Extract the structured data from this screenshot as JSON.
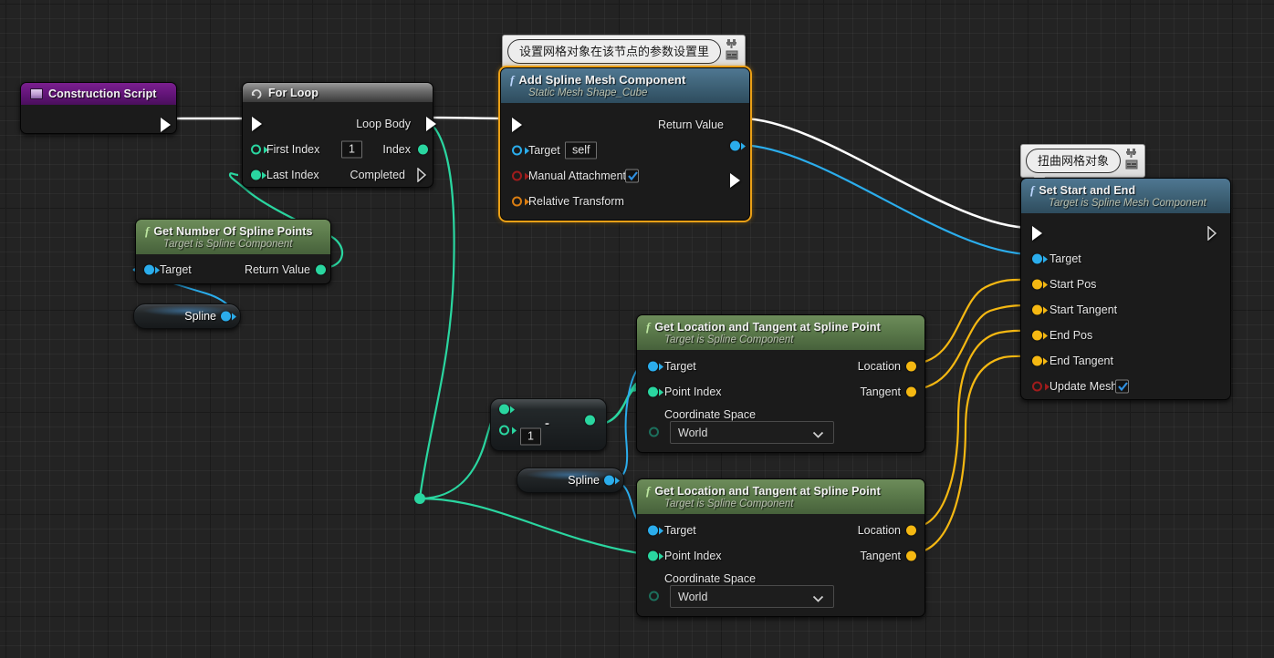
{
  "app": {
    "name": "Unreal Engine Blueprint Graph",
    "canvas_bg": "#232323"
  },
  "colors": {
    "exec_white": "#ffffff",
    "object_blue": "#2badec",
    "integer_green": "#2ad6a0",
    "vector_yellow": "#f5b812",
    "boolean_red": "#a01c1c",
    "transform_orange": "#d97d12",
    "selection_orange": "#eba016",
    "event_purple": "#7b1f8f"
  },
  "comments": [
    {
      "id": "comment-mesh-settings",
      "text": "设置网格对象在该节点的参数设置里",
      "attached_to": "Add Spline Mesh Component"
    },
    {
      "id": "comment-twist-mesh",
      "text": "扭曲网格对象",
      "attached_to": "Set Start and End"
    }
  ],
  "nodes": [
    {
      "id": "construction-script",
      "title": "Construction Script",
      "subtitle": "",
      "kind": "event",
      "icon": "event-icon",
      "outputs": [
        {
          "label": "",
          "type": "exec"
        }
      ],
      "inputs": []
    },
    {
      "id": "for-loop",
      "title": "For Loop",
      "subtitle": "",
      "kind": "flow-control",
      "icon": "loop-icon",
      "inputs": [
        {
          "label": "",
          "type": "exec"
        },
        {
          "label": "First Index",
          "type": "integer",
          "value": "1",
          "connected": false
        },
        {
          "label": "Last Index",
          "type": "integer",
          "connected": true
        }
      ],
      "outputs": [
        {
          "label": "Loop Body",
          "type": "exec"
        },
        {
          "label": "Index",
          "type": "integer"
        },
        {
          "label": "Completed",
          "type": "exec",
          "connected": false
        }
      ]
    },
    {
      "id": "add-spline-mesh-component",
      "title": "Add Spline Mesh Component",
      "subtitle": "Static Mesh Shape_Cube",
      "kind": "function-blue",
      "selected": true,
      "inputs": [
        {
          "label": "",
          "type": "exec"
        },
        {
          "label": "Target",
          "type": "object",
          "value": "self",
          "connected": false
        },
        {
          "label": "Manual Attachment",
          "type": "boolean",
          "checked": true
        },
        {
          "label": "Relative Transform",
          "type": "transform",
          "connected": false
        }
      ],
      "outputs": [
        {
          "label": "",
          "type": "exec"
        },
        {
          "label": "Return Value",
          "type": "object"
        }
      ]
    },
    {
      "id": "get-number-of-spline-points",
      "title": "Get Number Of Spline Points",
      "subtitle": "Target is Spline Component",
      "kind": "function-green",
      "inputs": [
        {
          "label": "Target",
          "type": "object",
          "connected": true
        }
      ],
      "outputs": [
        {
          "label": "Return Value",
          "type": "integer"
        }
      ]
    },
    {
      "id": "spline-var-1",
      "title": "Spline",
      "kind": "variable-get",
      "outputs": [
        {
          "label": "Spline",
          "type": "object"
        }
      ]
    },
    {
      "id": "subtract-node",
      "title": "-",
      "kind": "math",
      "operator": "-",
      "inputs": [
        {
          "label": "",
          "type": "integer",
          "connected": true
        },
        {
          "label": "",
          "type": "integer",
          "value": "1",
          "connected": false
        }
      ],
      "outputs": [
        {
          "label": "",
          "type": "integer"
        }
      ]
    },
    {
      "id": "spline-var-2",
      "title": "Spline",
      "kind": "variable-get",
      "outputs": [
        {
          "label": "Spline",
          "type": "object"
        }
      ]
    },
    {
      "id": "get-location-tangent-1",
      "title": "Get Location and Tangent at Spline Point",
      "subtitle": "Target is Spline Component",
      "kind": "function-green",
      "inputs": [
        {
          "label": "Target",
          "type": "object",
          "connected": true
        },
        {
          "label": "Point Index",
          "type": "integer",
          "connected": true
        },
        {
          "label": "Coordinate Space",
          "type": "enum",
          "value": "World",
          "connected": false
        }
      ],
      "outputs": [
        {
          "label": "Location",
          "type": "vector"
        },
        {
          "label": "Tangent",
          "type": "vector"
        }
      ]
    },
    {
      "id": "get-location-tangent-2",
      "title": "Get Location and Tangent at Spline Point",
      "subtitle": "Target is Spline Component",
      "kind": "function-green",
      "inputs": [
        {
          "label": "Target",
          "type": "object",
          "connected": true
        },
        {
          "label": "Point Index",
          "type": "integer",
          "connected": true
        },
        {
          "label": "Coordinate Space",
          "type": "enum",
          "value": "World",
          "connected": false
        }
      ],
      "outputs": [
        {
          "label": "Location",
          "type": "vector"
        },
        {
          "label": "Tangent",
          "type": "vector"
        }
      ]
    },
    {
      "id": "set-start-and-end",
      "title": "Set Start and End",
      "subtitle": "Target is Spline Mesh Component",
      "kind": "function-blue",
      "inputs": [
        {
          "label": "",
          "type": "exec"
        },
        {
          "label": "Target",
          "type": "object",
          "connected": true
        },
        {
          "label": "Start Pos",
          "type": "vector",
          "connected": true
        },
        {
          "label": "Start Tangent",
          "type": "vector",
          "connected": true
        },
        {
          "label": "End Pos",
          "type": "vector",
          "connected": true
        },
        {
          "label": "End Tangent",
          "type": "vector",
          "connected": true
        },
        {
          "label": "Update Mesh",
          "type": "boolean",
          "checked": true
        }
      ],
      "outputs": [
        {
          "label": "",
          "type": "exec",
          "connected": false
        }
      ]
    }
  ],
  "labels": {
    "construction_script": "Construction Script",
    "for_loop": "For Loop",
    "first_index": "First Index",
    "first_index_value": "1",
    "last_index": "Last Index",
    "loop_body": "Loop Body",
    "index": "Index",
    "completed": "Completed",
    "add_spline_mesh_title": "Add Spline Mesh Component",
    "add_spline_mesh_sub": "Static Mesh Shape_Cube",
    "target": "Target",
    "target_self": "self",
    "manual_attachment": "Manual Attachment",
    "relative_transform": "Relative Transform",
    "return_value": "Return Value",
    "get_num_spline_points_title": "Get Number Of Spline Points",
    "target_is_spline_component": "Target is Spline Component",
    "spline": "Spline",
    "subtract_op": "-",
    "subtract_value": "1",
    "get_loc_tangent_title": "Get Location and Tangent at Spline Point",
    "point_index": "Point Index",
    "coordinate_space": "Coordinate Space",
    "world": "World",
    "location": "Location",
    "tangent": "Tangent",
    "set_start_end_title": "Set Start and End",
    "set_start_end_sub": "Target is Spline Mesh Component",
    "start_pos": "Start Pos",
    "start_tangent": "Start Tangent",
    "end_pos": "End Pos",
    "end_tangent": "End Tangent",
    "update_mesh": "Update Mesh",
    "comment_1": "设置网格对象在该节点的参数设置里",
    "comment_2": "扭曲网格对象"
  }
}
